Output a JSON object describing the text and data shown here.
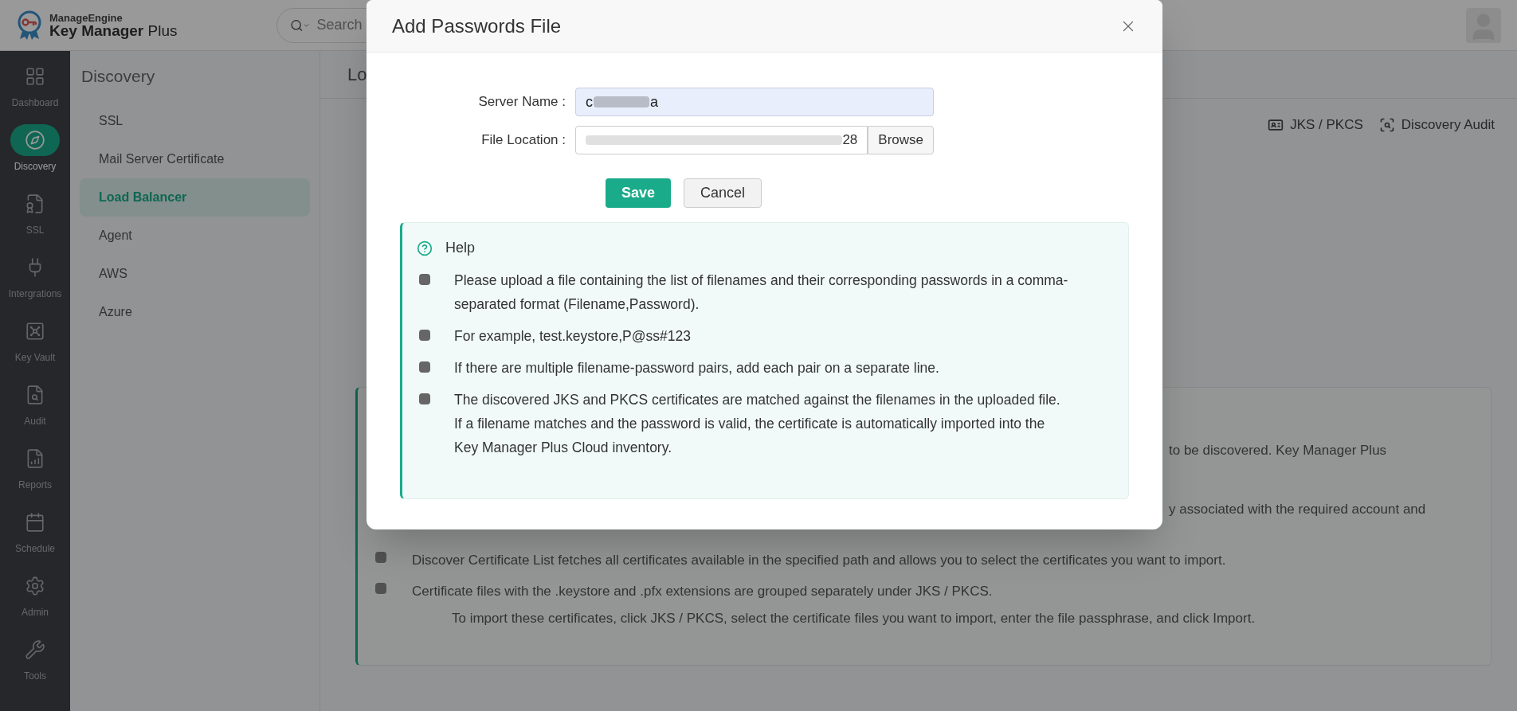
{
  "header": {
    "brand_top": "ManageEngine",
    "brand_main": "Key Manager",
    "brand_suffix": "Plus",
    "search": {
      "placeholder": "Search"
    }
  },
  "rail": [
    {
      "label": "Dashboard",
      "selected": false
    },
    {
      "label": "Discovery",
      "selected": true
    },
    {
      "label": "SSL",
      "selected": false
    },
    {
      "label": "Intergrations",
      "selected": false
    },
    {
      "label": "Key Vault",
      "selected": false
    },
    {
      "label": "Audit",
      "selected": false
    },
    {
      "label": "Reports",
      "selected": false
    },
    {
      "label": "Schedule",
      "selected": false
    },
    {
      "label": "Admin",
      "selected": false
    },
    {
      "label": "Tools",
      "selected": false
    }
  ],
  "submenu": {
    "title": "Discovery",
    "items": [
      {
        "label": "SSL",
        "selected": false
      },
      {
        "label": "Mail Server Certificate",
        "selected": false
      },
      {
        "label": "Load Balancer",
        "selected": true
      },
      {
        "label": "Agent",
        "selected": false
      },
      {
        "label": "AWS",
        "selected": false
      },
      {
        "label": "Azure",
        "selected": false
      }
    ]
  },
  "content": {
    "title_visible": "Lo",
    "actions": [
      {
        "label": "JKS / PKCS"
      },
      {
        "label": "Discovery Audit"
      }
    ],
    "help_fragments": [
      "to be discovered. Key Manager Plus",
      "y associated with the required account and"
    ],
    "help_items": [
      {
        "text": "Discover Certificate List fetches all certificates available in the specified path and allows you to select the certificates you want to import."
      },
      {
        "text": "Certificate files with the .keystore and .pfx extensions are grouped separately under JKS / PKCS.",
        "subtext": "To import these certificates, click JKS / PKCS, select the certificate files you want to import, enter the file passphrase, and click Import."
      }
    ]
  },
  "dialog": {
    "title": "Add Passwords File",
    "fields": [
      {
        "label": "Server Name :",
        "kind": "text",
        "value_start": "c",
        "value_end": "a"
      },
      {
        "label": "File Location :",
        "kind": "file",
        "value_end": "28",
        "button": "Browse"
      }
    ],
    "buttons": [
      {
        "label": "Save",
        "kind": "primary"
      },
      {
        "label": "Cancel",
        "kind": "secondary"
      }
    ],
    "help": {
      "title": "Help",
      "items": [
        "Please upload a file containing the list of filenames and their corresponding passwords in a comma-separated format (Filename,Password).",
        "For example, test.keystore,P@ss#123",
        "If there are multiple filename-password pairs, add each pair on a separate line.",
        "The discovered JKS and PKCS certificates are matched against the filenames in the uploaded file. If a filename matches and the password is valid, the certificate is automatically imported into the Key Manager Plus Cloud inventory."
      ]
    }
  }
}
